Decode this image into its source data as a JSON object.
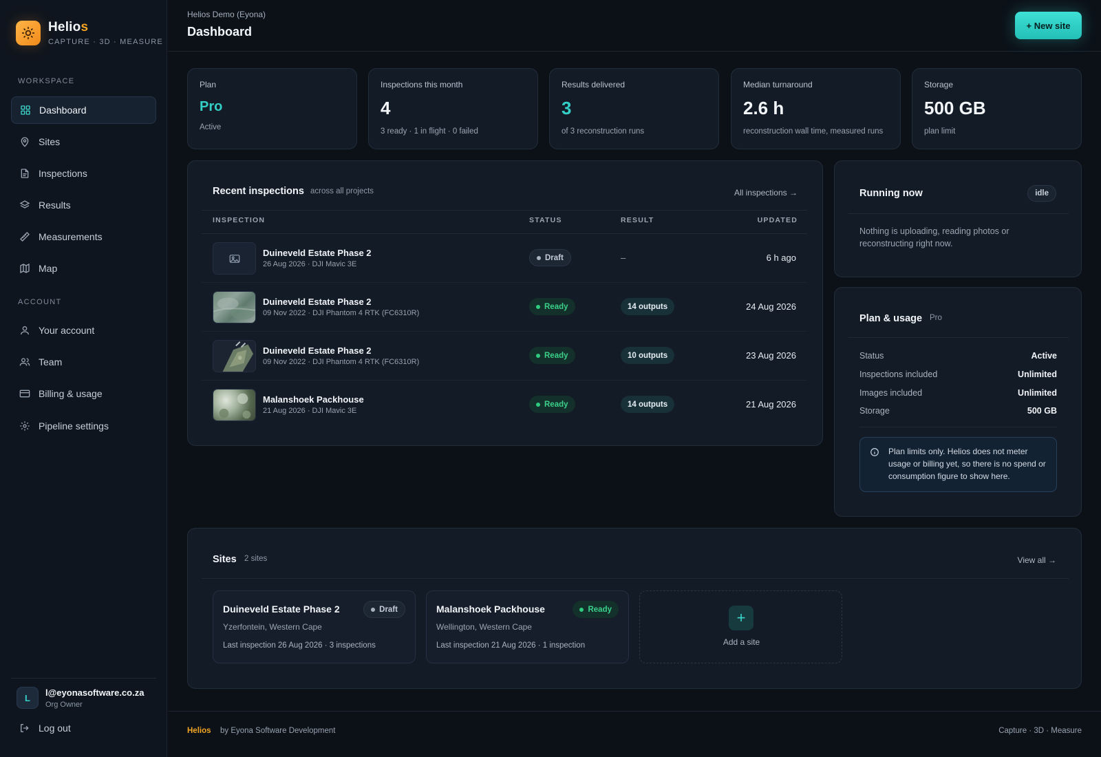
{
  "brand": {
    "name_main": "Helio",
    "name_accent": "s",
    "tagline": "CAPTURE · 3D · MEASURE",
    "logo_icon": "sun-icon"
  },
  "sidebar": {
    "workspace_label": "WORKSPACE",
    "account_label": "ACCOUNT",
    "workspace_items": [
      {
        "label": "Dashboard",
        "icon": "grid-icon"
      },
      {
        "label": "Sites",
        "icon": "map-pin-icon"
      },
      {
        "label": "Inspections",
        "icon": "document-icon"
      },
      {
        "label": "Results",
        "icon": "layers-icon"
      },
      {
        "label": "Measurements",
        "icon": "ruler-icon"
      },
      {
        "label": "Map",
        "icon": "map-icon"
      }
    ],
    "account_items": [
      {
        "label": "Your account",
        "icon": "user-icon"
      },
      {
        "label": "Team",
        "icon": "users-icon"
      },
      {
        "label": "Billing & usage",
        "icon": "credit-card-icon"
      },
      {
        "label": "Pipeline settings",
        "icon": "gear-icon"
      }
    ],
    "user": {
      "initial": "L",
      "email": "l@eyonasoftware.co.za",
      "role": "Org Owner"
    },
    "logout_label": "Log out"
  },
  "header": {
    "breadcrumb": "Helios Demo (Eyona)",
    "title": "Dashboard",
    "new_site_label": "+ New site"
  },
  "stats": [
    {
      "label": "Plan",
      "value": "Pro",
      "sub": "Active"
    },
    {
      "label": "Inspections this month",
      "value": "4",
      "sub": "3 ready · 1 in flight · 0 failed"
    },
    {
      "label": "Results delivered",
      "value": "3",
      "sub": "of 3 reconstruction runs"
    },
    {
      "label": "Median turnaround",
      "value": "2.6 h",
      "sub": "reconstruction wall time, measured runs"
    },
    {
      "label": "Storage",
      "value": "500 GB",
      "sub": "plan limit"
    }
  ],
  "recent": {
    "title": "Recent inspections",
    "subtitle": "across all projects",
    "link": "All inspections →",
    "columns": {
      "inspection": "INSPECTION",
      "status": "STATUS",
      "result": "RESULT",
      "updated": "UPDATED"
    },
    "rows": [
      {
        "name": "Duineveld Estate Phase 2",
        "meta": "26 Aug 2026 · DJI Mavic 3E",
        "status": "Draft",
        "result": "–",
        "updated": "6 h ago"
      },
      {
        "name": "Duineveld Estate Phase 2",
        "meta": "09 Nov 2022 · DJI Phantom 4 RTK (FC6310R)",
        "status": "Ready",
        "result": "14 outputs",
        "updated": "24 Aug 2026"
      },
      {
        "name": "Duineveld Estate Phase 2",
        "meta": "09 Nov 2022 · DJI Phantom 4 RTK (FC6310R)",
        "status": "Ready",
        "result": "10 outputs",
        "updated": "23 Aug 2026"
      },
      {
        "name": "Malanshoek Packhouse",
        "meta": "21 Aug 2026 · DJI Mavic 3E",
        "status": "Ready",
        "result": "14 outputs",
        "updated": "21 Aug 2026"
      }
    ]
  },
  "running": {
    "title": "Running now",
    "badge": "idle",
    "text": "Nothing is uploading, reading photos or reconstructing right now."
  },
  "plan_usage": {
    "title": "Plan & usage",
    "badge": "Pro",
    "rows": [
      {
        "key": "Status",
        "value": "Active"
      },
      {
        "key": "Inspections included",
        "value": "Unlimited"
      },
      {
        "key": "Images included",
        "value": "Unlimited"
      },
      {
        "key": "Storage",
        "value": "500 GB"
      }
    ],
    "note": "Plan limits only. Helios does not meter usage or billing yet, so there is no spend or consumption figure to show here."
  },
  "sites": {
    "title": "Sites",
    "count": "2 sites",
    "link": "View all →",
    "items": [
      {
        "name": "Duineveld Estate Phase 2",
        "status": "Draft",
        "location": "Yzerfontein, Western Cape",
        "last": "Last inspection 26 Aug 2026 · 3 inspections"
      },
      {
        "name": "Malanshoek Packhouse",
        "status": "Ready",
        "location": "Wellington, Western Cape",
        "last": "Last inspection 21 Aug 2026 · 1 inspection"
      }
    ],
    "add_label": "Add a site"
  },
  "footer": {
    "brand": "Helios",
    "by": "by Eyona Software Development",
    "right": "Capture · 3D · Measure"
  },
  "colors": {
    "accent": "#33cfc6",
    "brand": "#f5a623",
    "ready": "#2fcc80",
    "background": "#0c1118"
  }
}
